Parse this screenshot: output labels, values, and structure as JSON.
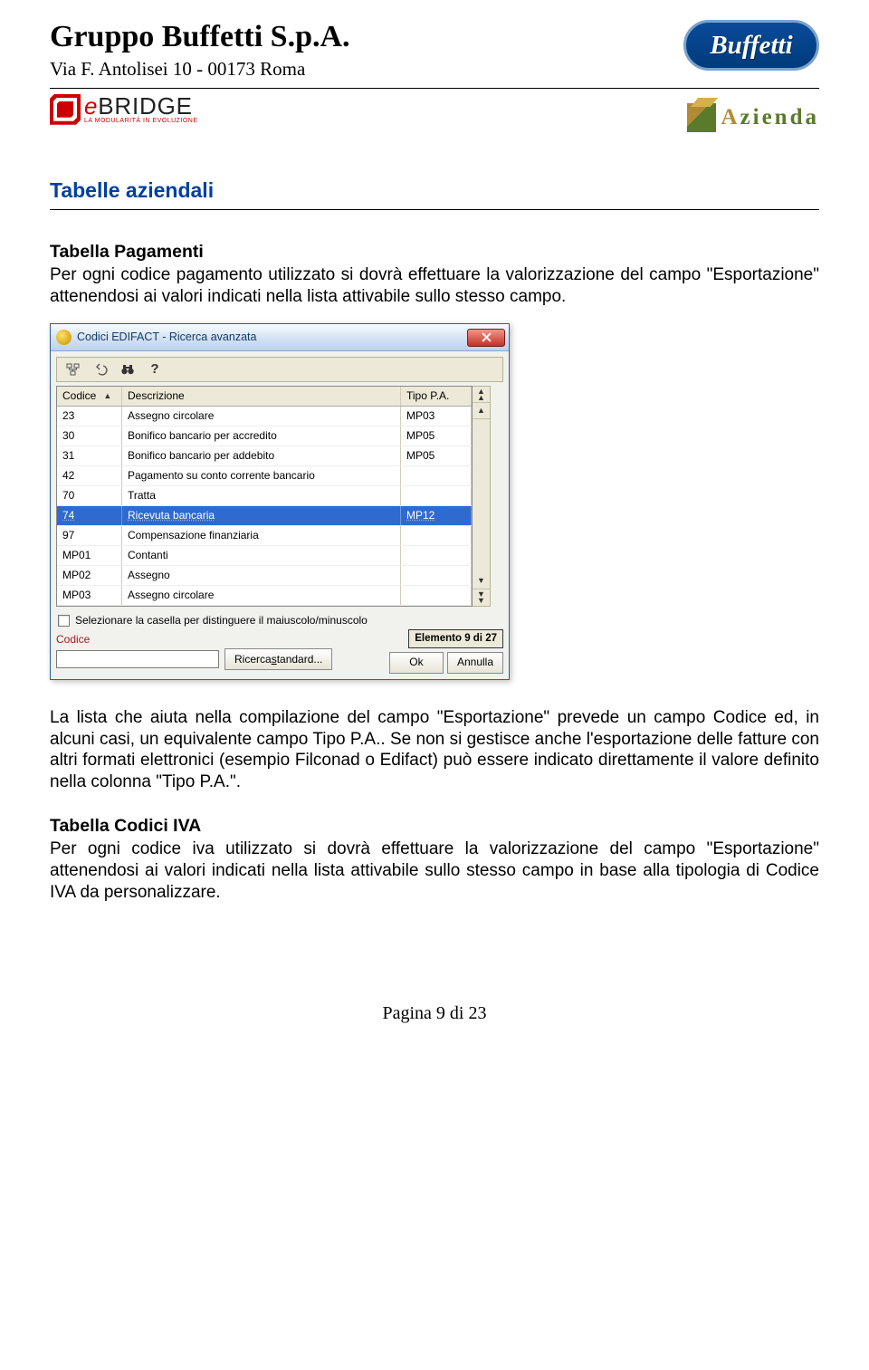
{
  "header": {
    "company": "Gruppo Buffetti S.p.A.",
    "address": "Via F. Antolisei 10 - 00173 Roma",
    "buffetti_logo_text": "Buffetti",
    "ebridge_main_e": "e",
    "ebridge_main_b": "BRIDGE",
    "ebridge_sub": "LA MODULARITÀ IN EVOLUZIONE",
    "azienda_a": "A",
    "azienda_rest": "zienda"
  },
  "section": {
    "title": "Tabelle aziendali",
    "tab_pag_title": "Tabella Pagamenti",
    "tab_pag_para": "Per ogni codice pagamento utilizzato si dovrà effettuare la valorizzazione del campo \"Esportazione\" attenendosi ai valori indicati nella lista attivabile sullo stesso campo.",
    "para2": "La lista che aiuta nella compilazione del campo \"Esportazione\" prevede un campo Codice ed, in alcuni casi, un equivalente campo Tipo P.A.. Se non si gestisce anche l'esportazione delle fatture con altri formati elettronici (esempio Filconad o Edifact) può essere indicato direttamente il valore definito nella colonna \"Tipo P.A.\".",
    "tab_iva_title": "Tabella Codici IVA",
    "tab_iva_para": "Per ogni codice iva utilizzato si dovrà effettuare la valorizzazione del campo \"Esportazione\" attenendosi ai valori indicati nella lista attivabile sullo stesso campo in base alla tipologia di Codice IVA da personalizzare."
  },
  "dialog": {
    "title": "Codici EDIFACT - Ricerca avanzata",
    "headers": {
      "code": "Codice",
      "desc": "Descrizione",
      "tipo": "Tipo P.A."
    },
    "rows": [
      {
        "code": "23",
        "desc": "Assegno circolare",
        "tipo": "MP03"
      },
      {
        "code": "30",
        "desc": "Bonifico bancario per accredito",
        "tipo": "MP05"
      },
      {
        "code": "31",
        "desc": "Bonifico bancario per addebito",
        "tipo": "MP05"
      },
      {
        "code": "42",
        "desc": "Pagamento su conto corrente bancario",
        "tipo": ""
      },
      {
        "code": "70",
        "desc": "Tratta",
        "tipo": ""
      },
      {
        "code": "74",
        "desc": "Ricevuta bancaria",
        "tipo": "MP12"
      },
      {
        "code": "97",
        "desc": "Compensazione finanziaria",
        "tipo": ""
      },
      {
        "code": "MP01",
        "desc": "Contanti",
        "tipo": ""
      },
      {
        "code": "MP02",
        "desc": "Assegno",
        "tipo": ""
      },
      {
        "code": "MP03",
        "desc": "Assegno circolare",
        "tipo": ""
      }
    ],
    "selected_index": 5,
    "checkbox_label": "Selezionare la casella per distinguere il maiuscolo/minuscolo",
    "codice_label": "Codice",
    "codice_value": "",
    "el_count": "Elemento 9 di 27",
    "btn_ricerca_pre": "Ricerca ",
    "btn_ricerca_u": "s",
    "btn_ricerca_post": "tandard...",
    "btn_ok": "Ok",
    "btn_annulla": "Annulla"
  },
  "footer": "Pagina 9 di 23"
}
